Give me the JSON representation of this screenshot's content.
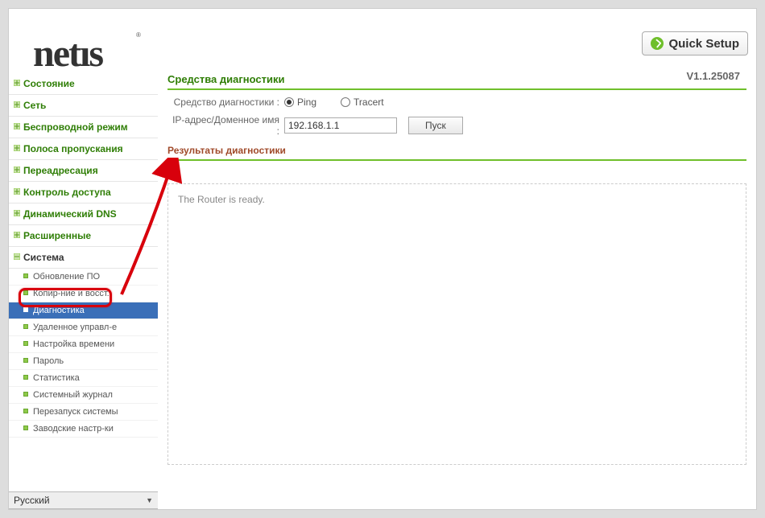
{
  "header": {
    "logo_text": "netıs",
    "quick_setup_label": "Quick Setup"
  },
  "version": "V1.1.25087",
  "sidebar": {
    "items": [
      {
        "label": "Состояние"
      },
      {
        "label": "Сеть"
      },
      {
        "label": "Беспроводной режим"
      },
      {
        "label": "Полоса пропускания"
      },
      {
        "label": "Переадресация"
      },
      {
        "label": "Контроль доступа"
      },
      {
        "label": "Динамический DNS"
      },
      {
        "label": "Расширенные"
      },
      {
        "label": "Система"
      }
    ],
    "subitems": [
      {
        "label": "Обновление ПО"
      },
      {
        "label": "Копир-ние и восст."
      },
      {
        "label": "Диагностика"
      },
      {
        "label": "Удаленное управл-е"
      },
      {
        "label": "Настройка времени"
      },
      {
        "label": "Пароль"
      },
      {
        "label": "Статистика"
      },
      {
        "label": "Системный журнал"
      },
      {
        "label": "Перезапуск системы"
      },
      {
        "label": "Заводские настр-ки"
      }
    ],
    "language": "Русский"
  },
  "content": {
    "title": "Средства диагностики",
    "tool_label": "Средство диагностики :",
    "ping": "Ping",
    "tracert": "Tracert",
    "ip_label": "IP-адрес/Доменное имя :",
    "ip_value": "192.168.1.1",
    "start_btn": "Пуск",
    "results_title": "Результаты диагностики",
    "result_text": "The Router is ready."
  }
}
